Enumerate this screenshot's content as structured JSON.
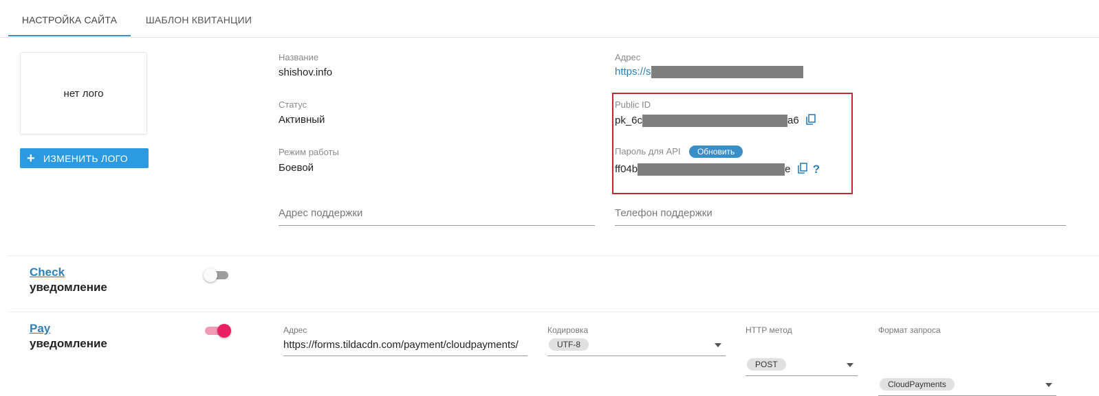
{
  "tabs": [
    {
      "label": "НАСТРОЙКА САЙТА",
      "active": true
    },
    {
      "label": "ШАБЛОН КВИТАНЦИИ",
      "active": false
    }
  ],
  "logo": {
    "placeholder_text": "нет лого",
    "change_button": "ИЗМЕНИТЬ ЛОГО"
  },
  "site": {
    "name_label": "Название",
    "name_value": "shishov.info",
    "status_label": "Статус",
    "status_value": "Активный",
    "mode_label": "Режим работы",
    "mode_value": "Боевой",
    "address_label": "Адрес",
    "address_prefix": "https://s",
    "public_id_label": "Public ID",
    "public_id_prefix": "pk_6c",
    "public_id_suffix": "a6",
    "api_password_label": "Пароль для API",
    "refresh_button": "Обновить",
    "api_password_prefix": "ff04b",
    "api_password_suffix": "e",
    "help_symbol": "?",
    "support_address_placeholder": "Адрес поддержки",
    "support_phone_placeholder": "Телефон поддержки"
  },
  "notifications": {
    "check": {
      "title": "Check",
      "subtitle": "уведомление",
      "enabled": false
    },
    "pay": {
      "title": "Pay",
      "subtitle": "уведомление",
      "enabled": true,
      "address_label": "Адрес",
      "address_value": "https://forms.tildacdn.com/payment/cloudpayments/",
      "encoding_label": "Кодировка",
      "encoding_value": "UTF-8",
      "method_label": "HTTP метод",
      "method_value": "POST",
      "format_label": "Формат запроса",
      "format_value": "CloudPayments"
    }
  },
  "colors": {
    "accent": "#3a8ec8",
    "button": "#2b9ae0",
    "link": "#2d7fb8",
    "highlight_box": "#c1272d",
    "toggle_on": "#e91e63"
  }
}
